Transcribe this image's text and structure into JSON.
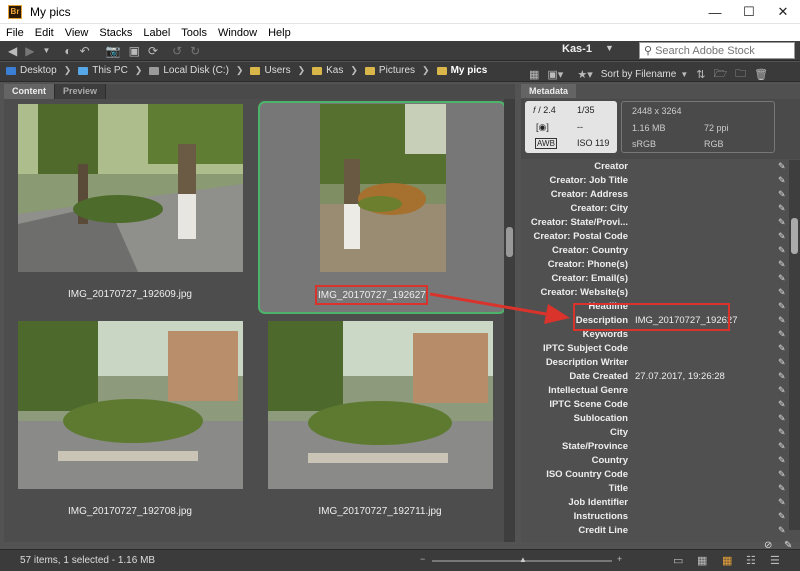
{
  "window": {
    "title": "My pics",
    "app_icon": "Br"
  },
  "window_controls": {
    "minimize": "—",
    "maximize": "☐",
    "close": "✕"
  },
  "menu": [
    "File",
    "Edit",
    "View",
    "Stacks",
    "Label",
    "Tools",
    "Window",
    "Help"
  ],
  "toolbar": {
    "workspace": "Kas-1",
    "stock_search_placeholder": "Search Adobe Stock"
  },
  "breadcrumbs": [
    "Desktop",
    "This PC",
    "Local Disk (C:)",
    "Users",
    "Kas",
    "Pictures",
    "My pics"
  ],
  "sort_label": "Sort by Filename",
  "tabs": {
    "content": "Content",
    "preview": "Preview"
  },
  "thumbnails": [
    {
      "filename": "IMG_20170727_192609.jpg",
      "selected": false
    },
    {
      "filename": "IMG_20170727_192627",
      "selected": true
    },
    {
      "filename": "IMG_20170727_192708.jpg",
      "selected": false
    },
    {
      "filename": "IMG_20170727_192711.jpg",
      "selected": false
    }
  ],
  "metadata": {
    "tab_label": "Metadata",
    "camera": {
      "aperture": "𝑓 / 2.4",
      "shutter": "1/35",
      "metering": "--",
      "iso": "ISO 119",
      "wb": "AWB"
    },
    "file": {
      "dimensions": "2448 x 3264",
      "size": "1.16 MB",
      "ppi": "72 ppi",
      "color_profile": "sRGB",
      "mode": "RGB"
    },
    "fields": [
      {
        "key": "Creator",
        "value": ""
      },
      {
        "key": "Creator: Job Title",
        "value": ""
      },
      {
        "key": "Creator: Address",
        "value": ""
      },
      {
        "key": "Creator: City",
        "value": ""
      },
      {
        "key": "Creator: State/Provi...",
        "value": ""
      },
      {
        "key": "Creator: Postal Code",
        "value": ""
      },
      {
        "key": "Creator: Country",
        "value": ""
      },
      {
        "key": "Creator: Phone(s)",
        "value": ""
      },
      {
        "key": "Creator: Email(s)",
        "value": ""
      },
      {
        "key": "Creator: Website(s)",
        "value": ""
      },
      {
        "key": "Headline",
        "value": ""
      },
      {
        "key": "Description",
        "value": "IMG_20170727_192627"
      },
      {
        "key": "Keywords",
        "value": ""
      },
      {
        "key": "IPTC Subject Code",
        "value": ""
      },
      {
        "key": "Description Writer",
        "value": ""
      },
      {
        "key": "Date Created",
        "value": "27.07.2017, 19:26:28"
      },
      {
        "key": "Intellectual Genre",
        "value": ""
      },
      {
        "key": "IPTC Scene Code",
        "value": ""
      },
      {
        "key": "Sublocation",
        "value": ""
      },
      {
        "key": "City",
        "value": ""
      },
      {
        "key": "State/Province",
        "value": ""
      },
      {
        "key": "Country",
        "value": ""
      },
      {
        "key": "ISO Country Code",
        "value": ""
      },
      {
        "key": "Title",
        "value": ""
      },
      {
        "key": "Job Identifier",
        "value": ""
      },
      {
        "key": "Instructions",
        "value": ""
      },
      {
        "key": "Credit Line",
        "value": ""
      }
    ]
  },
  "status": {
    "text": "57 items, 1 selected - 1.16 MB"
  },
  "colors": {
    "selection_border": "#4db36a",
    "annotation": "#d9332b"
  }
}
